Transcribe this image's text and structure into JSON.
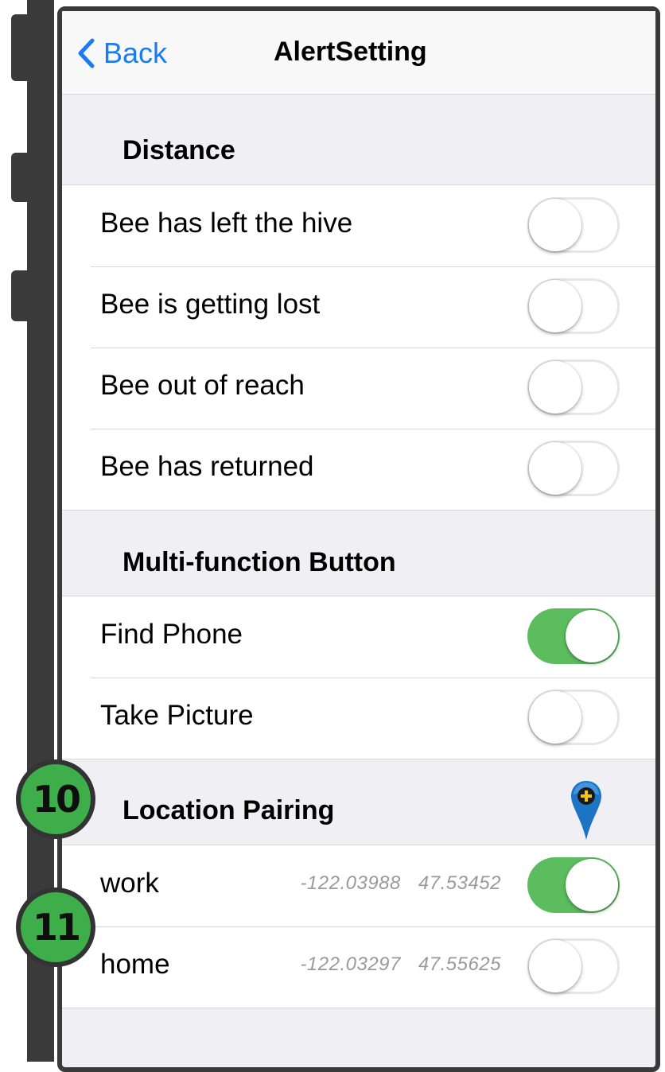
{
  "navbar": {
    "back_label": "Back",
    "title": "AlertSetting"
  },
  "sections": {
    "distance": {
      "title": "Distance",
      "rows": [
        {
          "label": "Bee has left the hive",
          "on": false
        },
        {
          "label": "Bee is getting lost",
          "on": false
        },
        {
          "label": "Bee out of reach",
          "on": false
        },
        {
          "label": "Bee has returned",
          "on": false
        }
      ]
    },
    "multi_function": {
      "title": "Multi-function Button",
      "rows": [
        {
          "label": "Find Phone",
          "on": true
        },
        {
          "label": "Take Picture",
          "on": false
        }
      ]
    },
    "location_pairing": {
      "title": "Location Pairing",
      "add_icon": "add-location-pin-icon",
      "rows": [
        {
          "label": "work",
          "lon": "-122.03988",
          "lat": "47.53452",
          "on": true
        },
        {
          "label": "home",
          "lon": "-122.03297",
          "lat": "47.55625",
          "on": false
        }
      ]
    }
  },
  "annotations": {
    "badge_a": "10",
    "badge_b": "11"
  },
  "colors": {
    "accent": "#1a7bf2",
    "toggle_on": "#5cbd5f",
    "badge": "#3dae49",
    "pin": "#1d74c4"
  }
}
